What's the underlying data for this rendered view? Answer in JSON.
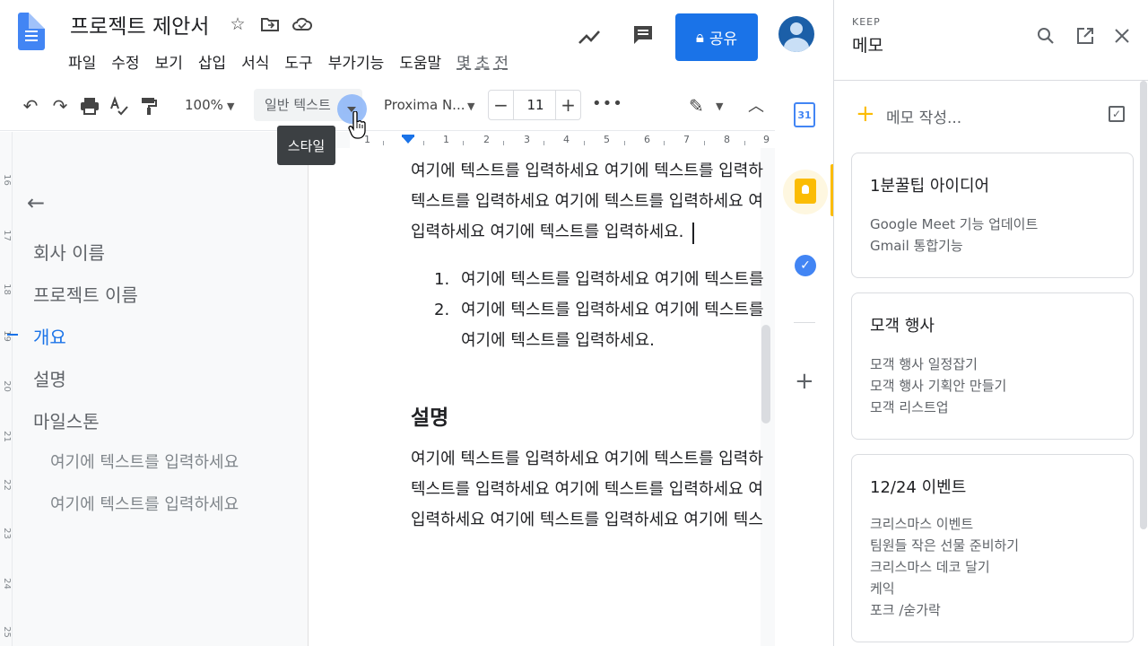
{
  "header": {
    "title": "프로젝트 제안서",
    "menu": [
      "파일",
      "수정",
      "보기",
      "삽입",
      "서식",
      "도구",
      "부가기능",
      "도움말",
      "몇 초 전"
    ],
    "share_label": "공유"
  },
  "toolbar": {
    "zoom": "100%",
    "style": "일반 텍스트",
    "font": "Proxima N...",
    "font_size": "11",
    "tooltip": "스타일"
  },
  "outline": {
    "items": [
      "회사 이름",
      "프로젝트 이름",
      "개요",
      "설명",
      "마일스톤"
    ],
    "sub_items": [
      "여기에 텍스트를 입력하세요",
      "여기에 텍스트를 입력하세요"
    ]
  },
  "ruler": {
    "h": [
      "1",
      "1",
      "2",
      "3",
      "4",
      "5",
      "6",
      "7",
      "8",
      "9"
    ],
    "v": [
      "16",
      "17",
      "18",
      "19",
      "20",
      "21",
      "22",
      "23",
      "24",
      "25"
    ]
  },
  "document": {
    "para1": [
      "여기에 텍스트를 입력하세요 여기에 텍스트를 입력하",
      "텍스트를 입력하세요 여기에 텍스트를 입력하세요 여",
      "입력하세요 여기에 텍스트를 입력하세요."
    ],
    "list": [
      {
        "num": "1.",
        "lines": [
          "여기에 텍스트를 입력하세요 여기에 텍스트를"
        ]
      },
      {
        "num": "2.",
        "lines": [
          "여기에 텍스트를 입력하세요 여기에 텍스트를",
          "여기에 텍스트를 입력하세요."
        ]
      }
    ],
    "heading": "설명",
    "para2": [
      "여기에 텍스트를 입력하세요 여기에 텍스트를 입력하",
      "텍스트를 입력하세요 여기에 텍스트를 입력하세요 여",
      "입력하세요 여기에 텍스트를 입력하세요 여기에 텍스"
    ]
  },
  "keep": {
    "brand": "KEEP",
    "title": "메모",
    "new_note": "메모 작성...",
    "notes": [
      {
        "title": "1분꿀팁 아이디어",
        "lines": [
          "Google Meet 기능 업데이트",
          "Gmail 통합기능"
        ]
      },
      {
        "title": "모객 행사",
        "lines": [
          "모객 행사 일정잡기",
          "모객 행사 기획안 만들기",
          "모객 리스트업"
        ]
      },
      {
        "title": "12/24 이벤트",
        "lines": [
          "크리스마스 이벤트",
          "팀원들 작은 선물 준비하기",
          "크리스마스 데코 달기",
          "케익",
          "포크 /숟가락"
        ]
      }
    ]
  },
  "side_panel": {
    "calendar_day": "31"
  },
  "colors": {
    "accent": "#1a73e8",
    "keep_yellow": "#fbbc04"
  }
}
